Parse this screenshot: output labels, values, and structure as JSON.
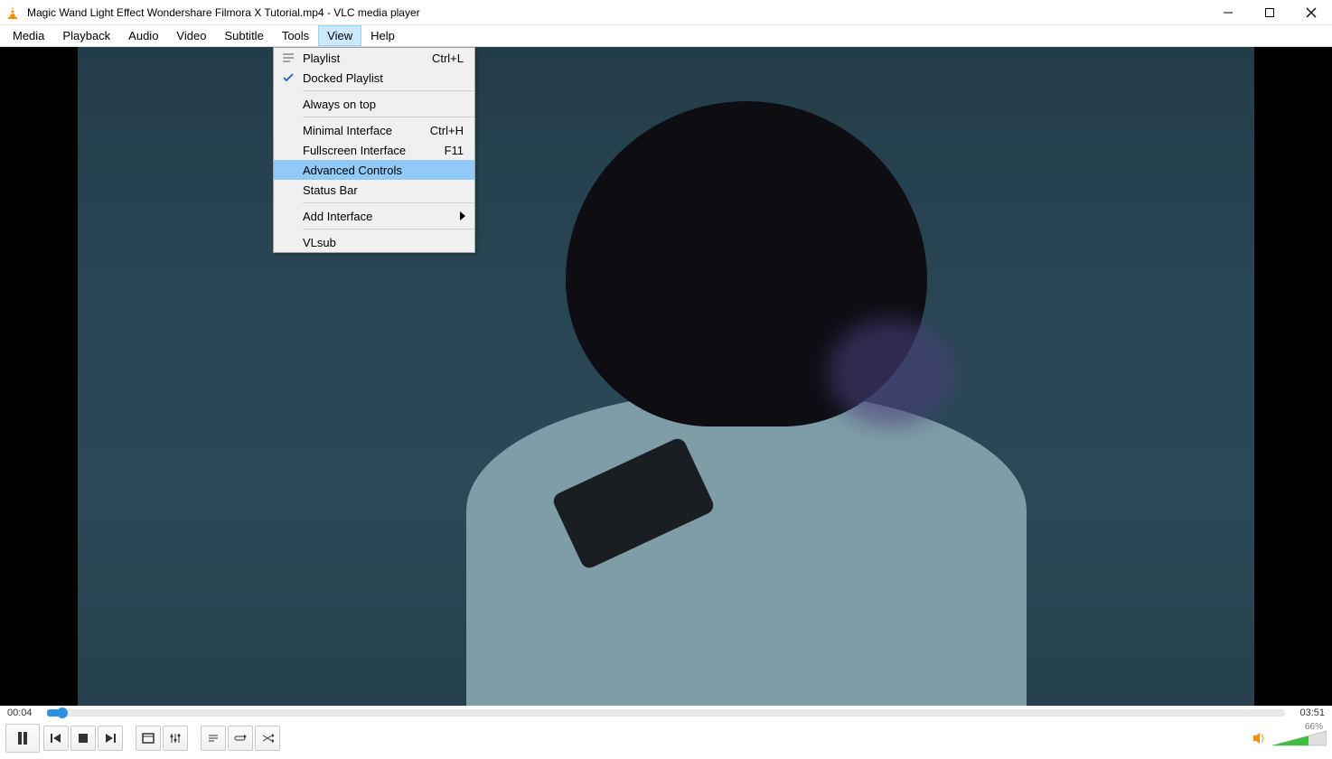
{
  "window": {
    "title": "Magic Wand Light Effect  Wondershare Filmora X Tutorial.mp4 - VLC media player"
  },
  "menubar": [
    "Media",
    "Playback",
    "Audio",
    "Video",
    "Subtitle",
    "Tools",
    "View",
    "Help"
  ],
  "active_menu_index": 6,
  "view_menu": {
    "items": [
      {
        "type": "item",
        "icon": "playlist",
        "label": "Playlist",
        "shortcut": "Ctrl+L"
      },
      {
        "type": "item",
        "icon": "check",
        "label": "Docked Playlist",
        "shortcut": ""
      },
      {
        "type": "sep"
      },
      {
        "type": "item",
        "icon": "",
        "label": "Always on top",
        "shortcut": ""
      },
      {
        "type": "sep"
      },
      {
        "type": "item",
        "icon": "",
        "label": "Minimal Interface",
        "shortcut": "Ctrl+H"
      },
      {
        "type": "item",
        "icon": "",
        "label": "Fullscreen Interface",
        "shortcut": "F11"
      },
      {
        "type": "item",
        "icon": "",
        "label": "Advanced Controls",
        "shortcut": "",
        "highlight": true
      },
      {
        "type": "item",
        "icon": "",
        "label": "Status Bar",
        "shortcut": ""
      },
      {
        "type": "sep"
      },
      {
        "type": "item",
        "icon": "",
        "label": "Add Interface",
        "shortcut": "",
        "submenu": true
      },
      {
        "type": "sep"
      },
      {
        "type": "item",
        "icon": "",
        "label": "VLsub",
        "shortcut": ""
      }
    ]
  },
  "playback": {
    "current_time": "00:04",
    "total_time": "03:51",
    "volume_pct": "66%"
  }
}
